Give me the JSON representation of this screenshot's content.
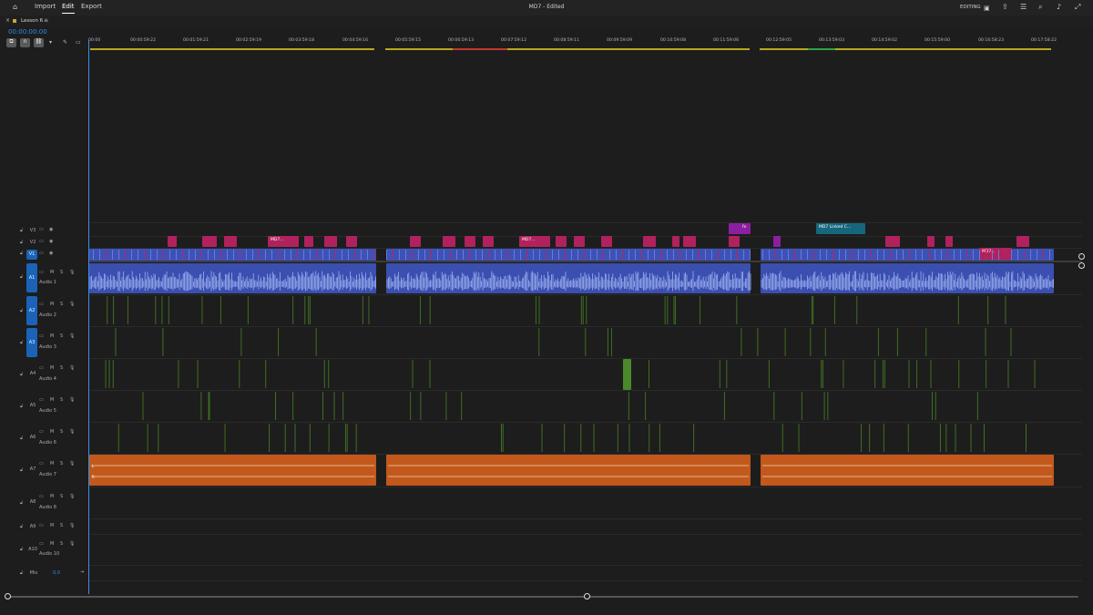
{
  "app": {
    "nav": [
      "Import",
      "Edit",
      "Export"
    ],
    "active_nav": "Edit",
    "title": "MD7 - Edited",
    "workspace": "EDITING"
  },
  "colors": {
    "accent": "#2d8ceb",
    "video_clip": "#b0225e",
    "video_v1": "#3c52b8",
    "audio_a1": "#3a4fb0",
    "audio_music": "#c2581c",
    "audio_sfx": "#4a8a2a",
    "adjust_purple": "#8b1fa0",
    "linked_teal": "#16677c"
  },
  "sequence": {
    "tab_label": "Lesson 6",
    "timecode": "00:00:00:00",
    "ruler_labels": [
      "00:00",
      "00:00:59:22",
      "00:01:59:21",
      "00:02:59:19",
      "00:03:59:18",
      "00:04:59:16",
      "00:05:59:15",
      "00:06:59:13",
      "00:07:59:12",
      "00:08:59:11",
      "00:09:59:09",
      "00:10:59:08",
      "00:11:59:06",
      "00:12:59:05",
      "00:13:59:03",
      "00:14:59:02",
      "00:15:59:00",
      "00:16:58:23",
      "00:17:58:22"
    ]
  },
  "tracks": {
    "video": [
      {
        "id": "V3",
        "name": ""
      },
      {
        "id": "V2",
        "name": ""
      },
      {
        "id": "V1",
        "name": ""
      }
    ],
    "audio": [
      {
        "id": "A1",
        "name": "Audio 1"
      },
      {
        "id": "A2",
        "name": "Audio 2"
      },
      {
        "id": "A3",
        "name": "Audio 3"
      },
      {
        "id": "A4",
        "name": "Audio 4"
      },
      {
        "id": "A5",
        "name": "Audio 5"
      },
      {
        "id": "A6",
        "name": "Audio 6"
      },
      {
        "id": "A7",
        "name": "Audio 7"
      },
      {
        "id": "A8",
        "name": "Audio 8"
      },
      {
        "id": "A9",
        "name": ""
      },
      {
        "id": "A10",
        "name": "Audio 10"
      }
    ],
    "mix": {
      "label": "Mix",
      "value": "0,0"
    },
    "control_labels": {
      "mute": "M",
      "solo": "S"
    }
  },
  "clips": {
    "labels": [
      "MD7...",
      "MD7...",
      "MD7 Linked C...",
      "MD7...",
      "fx",
      "L",
      "R"
    ]
  }
}
